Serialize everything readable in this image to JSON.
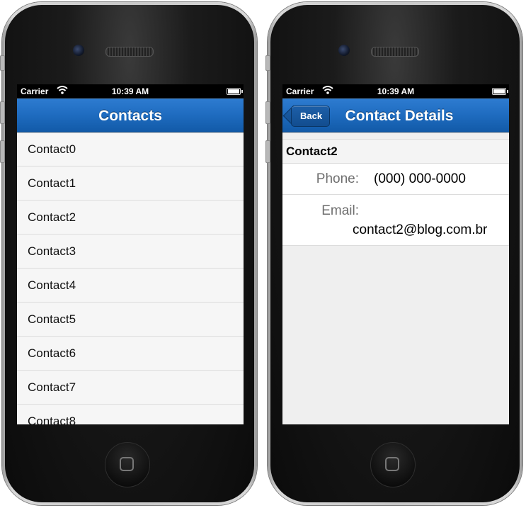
{
  "status_bar": {
    "carrier": "Carrier",
    "time": "10:39 AM"
  },
  "list_screen": {
    "title": "Contacts",
    "items": [
      "Contact0",
      "Contact1",
      "Contact2",
      "Contact3",
      "Contact4",
      "Contact5",
      "Contact6",
      "Contact7",
      "Contact8"
    ]
  },
  "detail_screen": {
    "title": "Contact Details",
    "back_label": "Back",
    "name": "Contact2",
    "phone_label": "Phone:",
    "phone_value": "(000) 000-0000",
    "email_label": "Email:",
    "email_value": "contact2@blog.com.br"
  },
  "colors": {
    "navbar": "#1e6bbf",
    "background": "#f1f1f1"
  },
  "icons": [
    "wifi-icon",
    "battery-icon",
    "camera-icon",
    "speaker-icon",
    "home-button-icon"
  ]
}
